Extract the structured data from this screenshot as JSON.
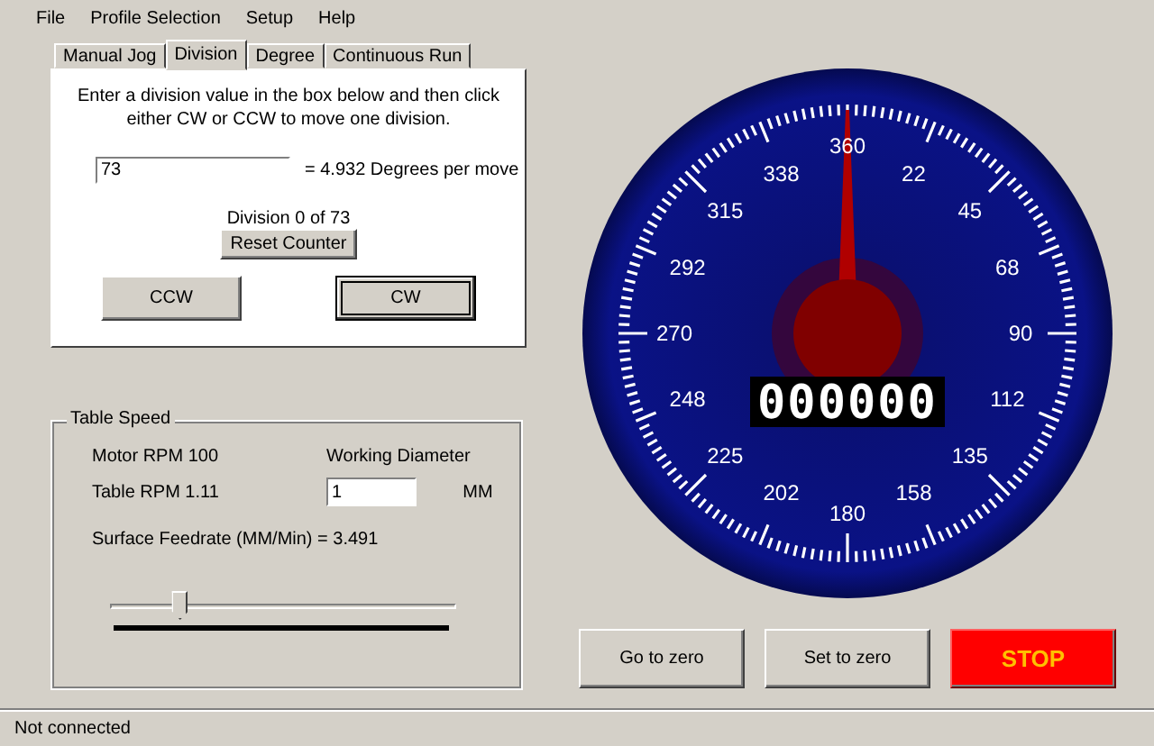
{
  "menu": [
    "File",
    "Profile Selection",
    "Setup",
    "Help"
  ],
  "tabs": [
    {
      "label": "Manual Jog",
      "selected": false
    },
    {
      "label": "Division",
      "selected": true
    },
    {
      "label": "Degree",
      "selected": false
    },
    {
      "label": "Continuous Run",
      "selected": false
    }
  ],
  "division": {
    "instructions": "Enter a division value in the box below and then click either CW or CCW to move one division.",
    "value": "73",
    "degrees_per_move": "= 4.932 Degrees per move",
    "counter": "Division 0 of 73",
    "reset_button": "Reset Counter",
    "buttons": [
      {
        "label": "CCW",
        "selected": false
      },
      {
        "label": "CW",
        "selected": true
      }
    ]
  },
  "table_speed": {
    "title": "Table Speed",
    "motor_rpm": "Motor RPM 100",
    "working_diameter_label": "Working Diameter",
    "table_rpm": "Table RPM 1.11",
    "diameter_value": "1",
    "unit": "MM",
    "surface_feedrate": "Surface Feedrate (MM/Min) = 3.491",
    "slider": {
      "level": 0.2
    }
  },
  "gauge": {
    "readout": "000000",
    "scale_labels": [
      "360",
      "22",
      "45",
      "68",
      "90",
      "112",
      "135",
      "158",
      "180",
      "202",
      "225",
      "248",
      "270",
      "292",
      "315",
      "338"
    ]
  },
  "buttons": [
    {
      "label": "Go to zero",
      "kind": "normal"
    },
    {
      "label": "Set to zero",
      "kind": "normal"
    },
    {
      "label": "STOP",
      "kind": "stop"
    }
  ],
  "status_bar": {
    "text": "Not connected"
  }
}
